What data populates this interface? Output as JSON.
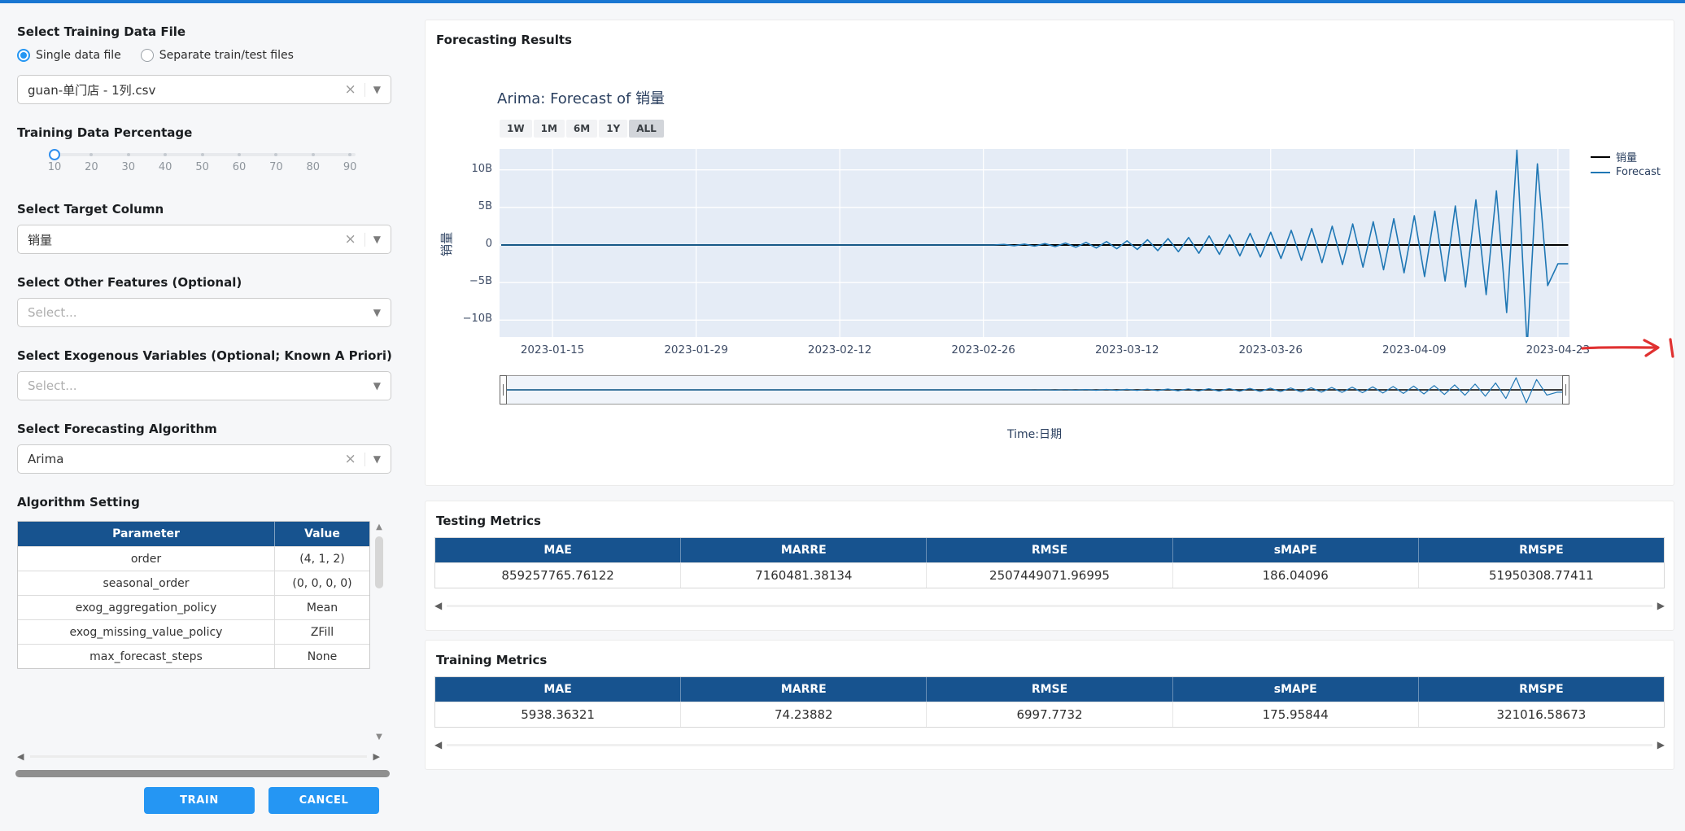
{
  "colors": {
    "topbar": "#1976d2",
    "accent_blue": "#2596f3",
    "table_header_bg": "#17538f",
    "plot_bg": "#e5ecf6",
    "forecast_line": "#1f77b4",
    "actual_line": "#000000",
    "annotation_red": "#e03131"
  },
  "sidebar": {
    "file_section": {
      "title": "Select Training Data File",
      "options": [
        {
          "label": "Single data file",
          "selected": true
        },
        {
          "label": "Separate train/test files",
          "selected": false
        }
      ],
      "file_dropdown_value": "guan-单门店 - 1列.csv"
    },
    "percentage_section": {
      "title": "Training Data Percentage",
      "marks": [
        "10",
        "20",
        "30",
        "40",
        "50",
        "60",
        "70",
        "80",
        "90"
      ],
      "value": "10"
    },
    "target_section": {
      "title": "Select Target Column",
      "value": "销量"
    },
    "features_section": {
      "title": "Select Other Features (Optional)",
      "placeholder": "Select..."
    },
    "exog_section": {
      "title": "Select Exogenous Variables (Optional; Known A Priori)",
      "placeholder": "Select..."
    },
    "algorithm_section": {
      "title": "Select Forecasting Algorithm",
      "value": "Arima"
    },
    "settings_section": {
      "title": "Algorithm Setting",
      "columns": [
        "Parameter",
        "Value"
      ],
      "rows": [
        {
          "parameter": "order",
          "value": "(4, 1, 2)"
        },
        {
          "parameter": "seasonal_order",
          "value": "(0, 0, 0, 0)"
        },
        {
          "parameter": "exog_aggregation_policy",
          "value": "Mean"
        },
        {
          "parameter": "exog_missing_value_policy",
          "value": "ZFill"
        },
        {
          "parameter": "max_forecast_steps",
          "value": "None"
        }
      ]
    },
    "train_button": "TRAIN",
    "cancel_button": "CANCEL"
  },
  "main": {
    "results_title": "Forecasting Results",
    "testing_metrics": {
      "title": "Testing Metrics",
      "columns": [
        "MAE",
        "MARRE",
        "RMSE",
        "sMAPE",
        "RMSPE"
      ],
      "values": [
        "859257765.76122",
        "7160481.38134",
        "2507449071.96995",
        "186.04096",
        "51950308.77411"
      ]
    },
    "training_metrics": {
      "title": "Training Metrics",
      "columns": [
        "MAE",
        "MARRE",
        "RMSE",
        "sMAPE",
        "RMSPE"
      ],
      "values": [
        "5938.36321",
        "74.23882",
        "6997.7732",
        "175.95844",
        "321016.58673"
      ]
    }
  },
  "chart_data": {
    "type": "line",
    "title": "Arima: Forecast of 销量",
    "xlabel": "Time:日期",
    "ylabel": "销量",
    "range_selector": [
      "1W",
      "1M",
      "6M",
      "1Y",
      "ALL"
    ],
    "active_range": "ALL",
    "x_start_date": "2023-01-10",
    "x_unit": "day",
    "x_range_days": [
      0,
      104
    ],
    "x_tick_labels": [
      "2023-01-15",
      "2023-01-29",
      "2023-02-12",
      "2023-02-26",
      "2023-03-12",
      "2023-03-26",
      "2023-04-09",
      "2023-04-23"
    ],
    "x_tick_days": [
      5,
      19,
      33,
      47,
      61,
      75,
      89,
      103
    ],
    "y_tick_labels": [
      "10B",
      "5B",
      "0",
      "−5B",
      "−10B"
    ],
    "y_tick_values_billions": [
      10,
      5,
      0,
      -5,
      -10
    ],
    "ylim_billions": [
      -12.5,
      12.8
    ],
    "grid": true,
    "legend_position": "right",
    "has_range_slider": true,
    "series": [
      {
        "name": "销量",
        "color": "#000000",
        "constant_billions": 0
      },
      {
        "name": "Forecast",
        "color": "#1f77b4",
        "values_billions": [
          0,
          0,
          0,
          0,
          0,
          0,
          0,
          0,
          0,
          0,
          0,
          0,
          0,
          0,
          0,
          0,
          0,
          0,
          0,
          0,
          0,
          0,
          0,
          0,
          0,
          0,
          0,
          0,
          0,
          0,
          0,
          0,
          0,
          0,
          0,
          0,
          0,
          0,
          0,
          0,
          0,
          0,
          0,
          0,
          0,
          0,
          0,
          0,
          0,
          0.08,
          -0.1,
          0.12,
          -0.15,
          0.18,
          -0.22,
          0.26,
          -0.3,
          0.35,
          -0.4,
          0.45,
          -0.5,
          0.55,
          -0.6,
          0.7,
          -0.75,
          0.85,
          -0.9,
          1.0,
          -1.1,
          1.2,
          -1.25,
          1.35,
          -1.45,
          1.55,
          -1.6,
          1.7,
          -1.8,
          1.95,
          -2.05,
          2.2,
          -2.35,
          2.5,
          -2.6,
          2.8,
          -2.95,
          3.1,
          -3.3,
          3.5,
          -3.7,
          3.9,
          -4.2,
          4.5,
          -4.8,
          5.2,
          -5.6,
          6.0,
          -6.6,
          7.2,
          -9.0,
          12.6,
          -13.6,
          10.8,
          -5.4,
          -2.5,
          -2.5
        ]
      }
    ],
    "annotation": "hand-drawn red arrow pointing right, after last x tick label"
  }
}
